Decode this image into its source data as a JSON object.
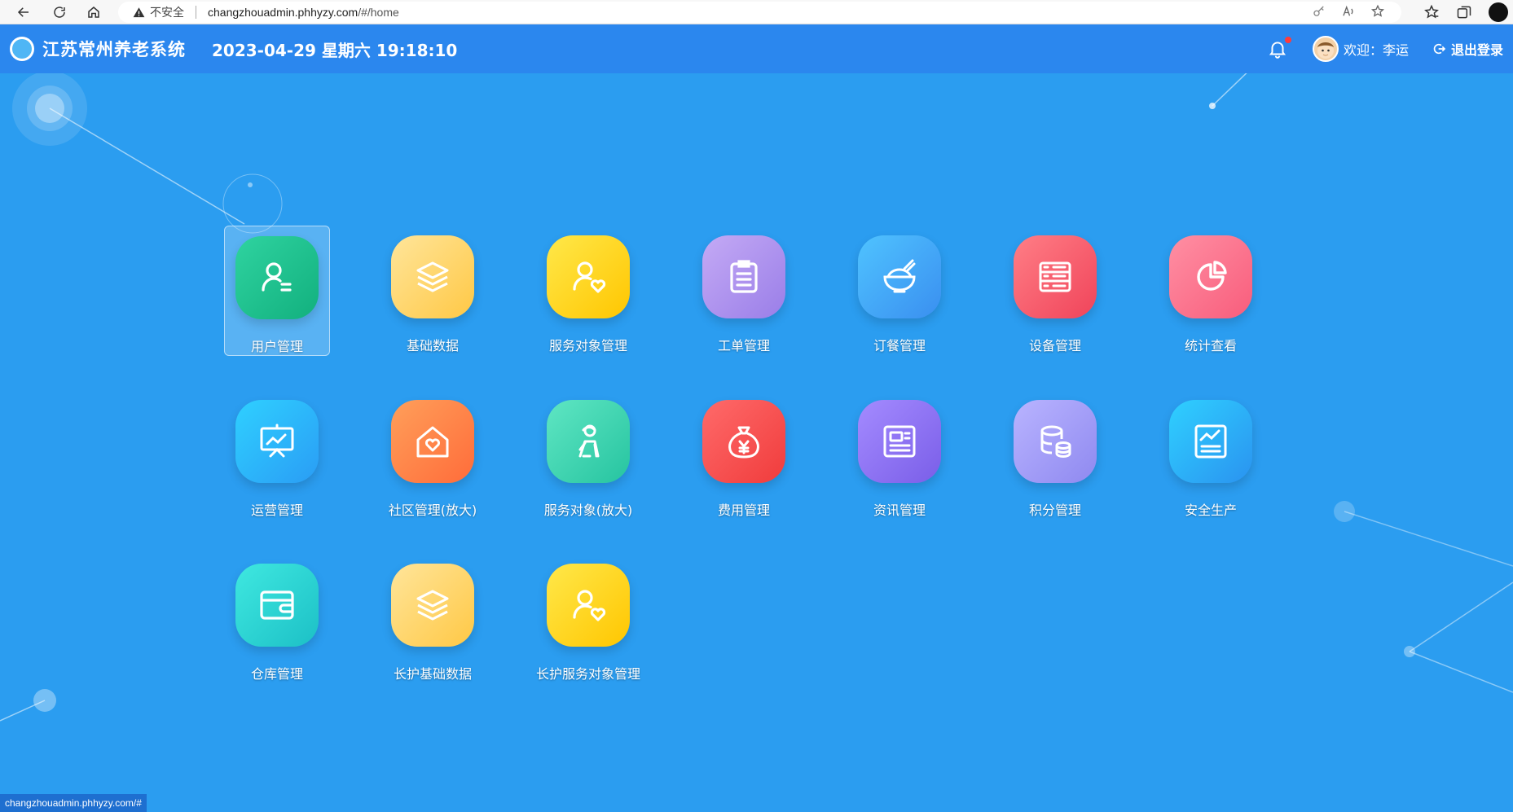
{
  "browser": {
    "security_label": "不安全",
    "url_host": "changzhouadmin.phhyzy.com",
    "url_path": "/#/home",
    "status_url": "changzhouadmin.phhyzy.com/#"
  },
  "header": {
    "title": "江苏常州养老系统",
    "datetime": "2023-04-29 星期六 19:18:10",
    "welcome": "欢迎：李运",
    "logout": "退出登录"
  },
  "tiles": [
    {
      "label": "用户管理",
      "icon": "user-list-icon",
      "color1": "#2fd3a0",
      "color2": "#12b07e",
      "selected": true
    },
    {
      "label": "基础数据",
      "icon": "layers-icon",
      "color1": "#ffe59a",
      "color2": "#ffc845"
    },
    {
      "label": "服务对象管理",
      "icon": "user-heart-icon",
      "color1": "#ffe84a",
      "color2": "#ffc600"
    },
    {
      "label": "工单管理",
      "icon": "clipboard-icon",
      "color1": "#c4aaf5",
      "color2": "#9a7ee8"
    },
    {
      "label": "订餐管理",
      "icon": "rice-bowl-icon",
      "color1": "#4fc3ff",
      "color2": "#3a8ff0"
    },
    {
      "label": "设备管理",
      "icon": "server-icon",
      "color1": "#ff7e86",
      "color2": "#f0445a"
    },
    {
      "label": "统计查看",
      "icon": "pie-chart-icon",
      "color1": "#ff8fa3",
      "color2": "#f85d7c"
    },
    {
      "label": "运营管理",
      "icon": "presentation-icon",
      "color1": "#2fd0ff",
      "color2": "#2a9df5"
    },
    {
      "label": "社区管理(放大)",
      "icon": "house-heart-icon",
      "color1": "#ff9f5a",
      "color2": "#ff6c3a"
    },
    {
      "label": "服务对象(放大)",
      "icon": "elderly-person-icon",
      "color1": "#5fe6c3",
      "color2": "#26c4a0"
    },
    {
      "label": "费用管理",
      "icon": "money-bag-icon",
      "color1": "#ff6a6a",
      "color2": "#f03c3c"
    },
    {
      "label": "资讯管理",
      "icon": "news-icon",
      "color1": "#a48bff",
      "color2": "#7a5ee8"
    },
    {
      "label": "积分管理",
      "icon": "database-icon",
      "color1": "#b9b4ff",
      "color2": "#8f89f0"
    },
    {
      "label": "安全生产",
      "icon": "report-icon",
      "color1": "#2fd0ff",
      "color2": "#2a93f0"
    },
    {
      "label": "仓库管理",
      "icon": "wallet-icon",
      "color1": "#3fe8e0",
      "color2": "#1cc0c6"
    },
    {
      "label": "长护基础数据",
      "icon": "layers-icon",
      "color1": "#ffe59a",
      "color2": "#ffc845"
    },
    {
      "label": "长护服务对象管理",
      "icon": "user-heart-icon",
      "color1": "#ffe84a",
      "color2": "#ffc600"
    }
  ]
}
